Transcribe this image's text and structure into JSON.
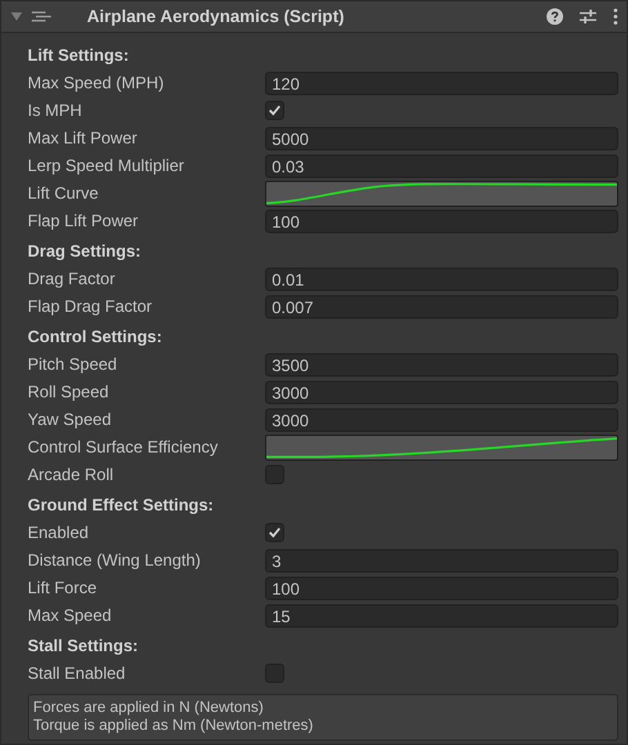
{
  "header": {
    "title": "Airplane Aerodynamics (Script)",
    "expanded": true
  },
  "sections": [
    {
      "title": "Lift Settings:",
      "fields": [
        {
          "kind": "text",
          "label": "Max Speed (MPH)",
          "value": "120"
        },
        {
          "kind": "checkbox",
          "label": "Is MPH",
          "checked": true
        },
        {
          "kind": "text",
          "label": "Max Lift Power",
          "value": "5000"
        },
        {
          "kind": "text",
          "label": "Lerp Speed Multiplier",
          "value": "0.03"
        },
        {
          "kind": "curve",
          "label": "Lift Curve"
        },
        {
          "kind": "text",
          "label": "Flap Lift Power",
          "value": "100"
        }
      ]
    },
    {
      "title": "Drag Settings:",
      "fields": [
        {
          "kind": "text",
          "label": "Drag Factor",
          "value": "0.01"
        },
        {
          "kind": "text",
          "label": "Flap Drag Factor",
          "value": "0.007"
        }
      ]
    },
    {
      "title": "Control Settings:",
      "fields": [
        {
          "kind": "text",
          "label": "Pitch Speed",
          "value": "3500"
        },
        {
          "kind": "text",
          "label": "Roll Speed",
          "value": "3000"
        },
        {
          "kind": "text",
          "label": "Yaw Speed",
          "value": "3000"
        },
        {
          "kind": "curve",
          "label": "Control Surface Efficiency"
        },
        {
          "kind": "checkbox",
          "label": "Arcade Roll",
          "checked": false
        }
      ]
    },
    {
      "title": "Ground Effect Settings:",
      "fields": [
        {
          "kind": "checkbox",
          "label": "Enabled",
          "checked": true
        },
        {
          "kind": "text",
          "label": "Distance (Wing Length)",
          "value": "3"
        },
        {
          "kind": "text",
          "label": "Lift Force",
          "value": "100"
        },
        {
          "kind": "text",
          "label": "Max Speed",
          "value": "15"
        }
      ]
    },
    {
      "title": "Stall Settings:",
      "fields": [
        {
          "kind": "checkbox",
          "label": "Stall Enabled",
          "checked": false
        }
      ]
    }
  ],
  "help_box": {
    "lines": [
      "Forces are applied in N (Newtons)",
      "Torque is applied as Nm (Newton-metres)"
    ]
  }
}
